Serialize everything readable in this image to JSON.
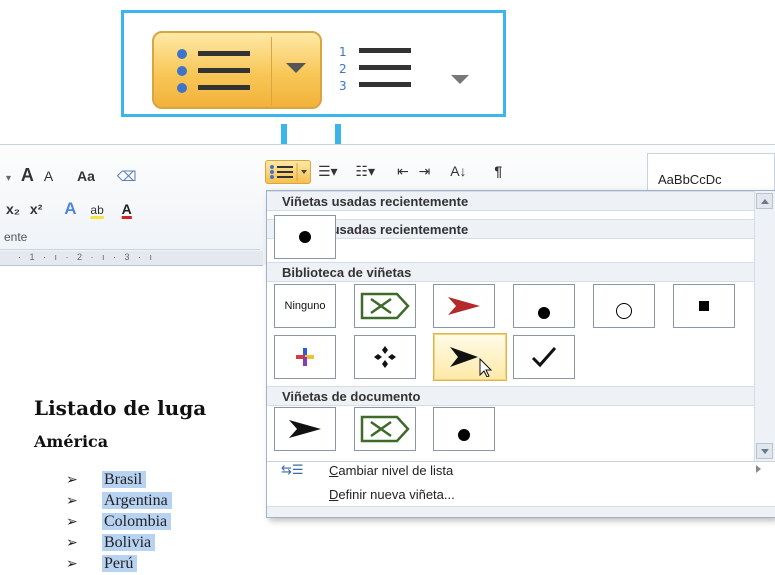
{
  "zoom": {
    "bullets_icon": "bullet-list-icon",
    "numbering_icon": "numbered-list-icon"
  },
  "ribbon": {
    "font_grow": "A",
    "font_shrink": "A",
    "change_case": "Aa",
    "subscript": "x₂",
    "superscript": "x²",
    "text_effect": "A",
    "highlight": "ab",
    "font_color": "A",
    "sort": "A↓",
    "pilcrow": "¶",
    "styles_preview": "AaBbCcDc",
    "group_caption": "ente",
    "ruler_marks": "· 1 · ı · 2 · ı · 3 · ı"
  },
  "dropdown": {
    "section_recent": "Viñetas usadas recientemente",
    "section_library": "Biblioteca de viñetas",
    "section_document": "Viñetas de documento",
    "none_label": "Ninguno",
    "menu_change_level_prefix": "C",
    "menu_change_level_rest": "ambiar nivel de lista",
    "menu_define_prefix": "D",
    "menu_define_rest": "efinir nueva viñeta..."
  },
  "document": {
    "title": "Listado de luga",
    "subtitle": "América",
    "items": [
      "Brasil",
      "Argentina",
      "Colombia",
      "Bolivia",
      "Perú"
    ],
    "marker": "➢"
  }
}
